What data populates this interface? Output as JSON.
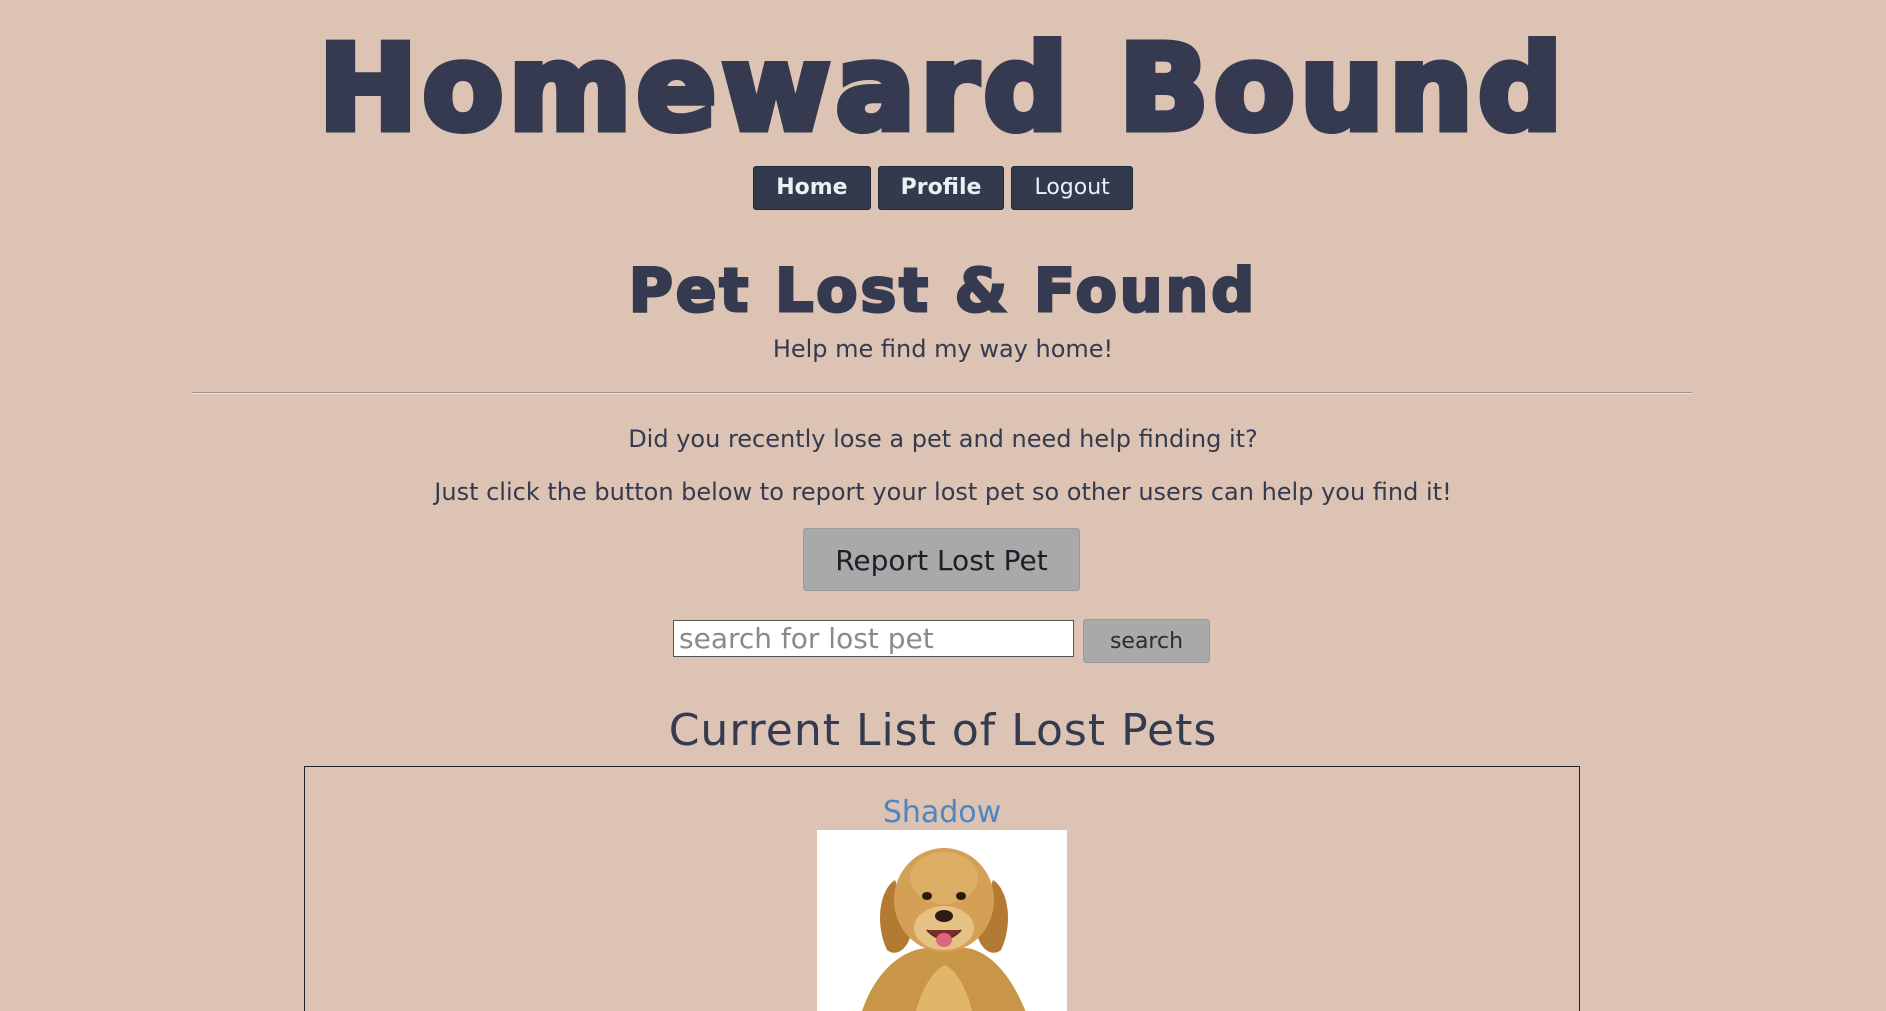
{
  "site": {
    "title": "Homeward Bound"
  },
  "nav": {
    "home_label": "Home",
    "profile_label": "Profile",
    "logout_label": "Logout"
  },
  "main": {
    "heading": "Pet Lost & Found",
    "tagline": "Help me find my way home!",
    "intro_question": "Did you recently lose a pet and need help finding it?",
    "intro_instruction": "Just click the button below to report your lost pet so other users can help you find it!",
    "report_button_label": "Report Lost Pet"
  },
  "search": {
    "placeholder": "search for lost pet",
    "value": "",
    "button_label": "search"
  },
  "lost_pets": {
    "title": "Current List of Lost Pets",
    "items": [
      {
        "name": "Shadow",
        "photo_icon": "golden-retriever-photo"
      }
    ]
  },
  "colors": {
    "background": "#dcc3b3",
    "text": "#343a4f",
    "nav_button": "#323b4d",
    "action_button": "#a9a9a9",
    "pet_link": "#4d86c1"
  }
}
